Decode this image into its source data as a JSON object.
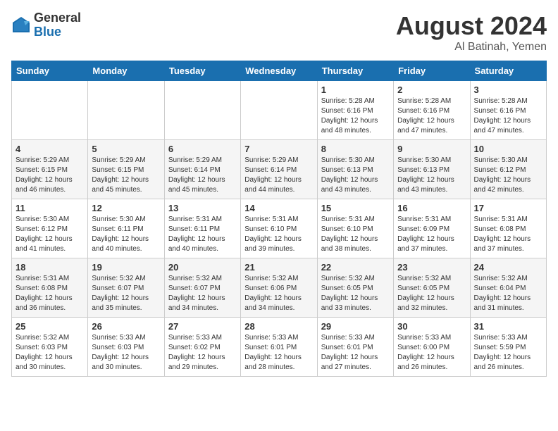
{
  "header": {
    "logo_general": "General",
    "logo_blue": "Blue",
    "month_year": "August 2024",
    "location": "Al Batinah, Yemen"
  },
  "weekdays": [
    "Sunday",
    "Monday",
    "Tuesday",
    "Wednesday",
    "Thursday",
    "Friday",
    "Saturday"
  ],
  "weeks": [
    [
      {
        "day": "",
        "info": ""
      },
      {
        "day": "",
        "info": ""
      },
      {
        "day": "",
        "info": ""
      },
      {
        "day": "",
        "info": ""
      },
      {
        "day": "1",
        "info": "Sunrise: 5:28 AM\nSunset: 6:16 PM\nDaylight: 12 hours\nand 48 minutes."
      },
      {
        "day": "2",
        "info": "Sunrise: 5:28 AM\nSunset: 6:16 PM\nDaylight: 12 hours\nand 47 minutes."
      },
      {
        "day": "3",
        "info": "Sunrise: 5:28 AM\nSunset: 6:16 PM\nDaylight: 12 hours\nand 47 minutes."
      }
    ],
    [
      {
        "day": "4",
        "info": "Sunrise: 5:29 AM\nSunset: 6:15 PM\nDaylight: 12 hours\nand 46 minutes."
      },
      {
        "day": "5",
        "info": "Sunrise: 5:29 AM\nSunset: 6:15 PM\nDaylight: 12 hours\nand 45 minutes."
      },
      {
        "day": "6",
        "info": "Sunrise: 5:29 AM\nSunset: 6:14 PM\nDaylight: 12 hours\nand 45 minutes."
      },
      {
        "day": "7",
        "info": "Sunrise: 5:29 AM\nSunset: 6:14 PM\nDaylight: 12 hours\nand 44 minutes."
      },
      {
        "day": "8",
        "info": "Sunrise: 5:30 AM\nSunset: 6:13 PM\nDaylight: 12 hours\nand 43 minutes."
      },
      {
        "day": "9",
        "info": "Sunrise: 5:30 AM\nSunset: 6:13 PM\nDaylight: 12 hours\nand 43 minutes."
      },
      {
        "day": "10",
        "info": "Sunrise: 5:30 AM\nSunset: 6:12 PM\nDaylight: 12 hours\nand 42 minutes."
      }
    ],
    [
      {
        "day": "11",
        "info": "Sunrise: 5:30 AM\nSunset: 6:12 PM\nDaylight: 12 hours\nand 41 minutes."
      },
      {
        "day": "12",
        "info": "Sunrise: 5:30 AM\nSunset: 6:11 PM\nDaylight: 12 hours\nand 40 minutes."
      },
      {
        "day": "13",
        "info": "Sunrise: 5:31 AM\nSunset: 6:11 PM\nDaylight: 12 hours\nand 40 minutes."
      },
      {
        "day": "14",
        "info": "Sunrise: 5:31 AM\nSunset: 6:10 PM\nDaylight: 12 hours\nand 39 minutes."
      },
      {
        "day": "15",
        "info": "Sunrise: 5:31 AM\nSunset: 6:10 PM\nDaylight: 12 hours\nand 38 minutes."
      },
      {
        "day": "16",
        "info": "Sunrise: 5:31 AM\nSunset: 6:09 PM\nDaylight: 12 hours\nand 37 minutes."
      },
      {
        "day": "17",
        "info": "Sunrise: 5:31 AM\nSunset: 6:08 PM\nDaylight: 12 hours\nand 37 minutes."
      }
    ],
    [
      {
        "day": "18",
        "info": "Sunrise: 5:31 AM\nSunset: 6:08 PM\nDaylight: 12 hours\nand 36 minutes."
      },
      {
        "day": "19",
        "info": "Sunrise: 5:32 AM\nSunset: 6:07 PM\nDaylight: 12 hours\nand 35 minutes."
      },
      {
        "day": "20",
        "info": "Sunrise: 5:32 AM\nSunset: 6:07 PM\nDaylight: 12 hours\nand 34 minutes."
      },
      {
        "day": "21",
        "info": "Sunrise: 5:32 AM\nSunset: 6:06 PM\nDaylight: 12 hours\nand 34 minutes."
      },
      {
        "day": "22",
        "info": "Sunrise: 5:32 AM\nSunset: 6:05 PM\nDaylight: 12 hours\nand 33 minutes."
      },
      {
        "day": "23",
        "info": "Sunrise: 5:32 AM\nSunset: 6:05 PM\nDaylight: 12 hours\nand 32 minutes."
      },
      {
        "day": "24",
        "info": "Sunrise: 5:32 AM\nSunset: 6:04 PM\nDaylight: 12 hours\nand 31 minutes."
      }
    ],
    [
      {
        "day": "25",
        "info": "Sunrise: 5:32 AM\nSunset: 6:03 PM\nDaylight: 12 hours\nand 30 minutes."
      },
      {
        "day": "26",
        "info": "Sunrise: 5:33 AM\nSunset: 6:03 PM\nDaylight: 12 hours\nand 30 minutes."
      },
      {
        "day": "27",
        "info": "Sunrise: 5:33 AM\nSunset: 6:02 PM\nDaylight: 12 hours\nand 29 minutes."
      },
      {
        "day": "28",
        "info": "Sunrise: 5:33 AM\nSunset: 6:01 PM\nDaylight: 12 hours\nand 28 minutes."
      },
      {
        "day": "29",
        "info": "Sunrise: 5:33 AM\nSunset: 6:01 PM\nDaylight: 12 hours\nand 27 minutes."
      },
      {
        "day": "30",
        "info": "Sunrise: 5:33 AM\nSunset: 6:00 PM\nDaylight: 12 hours\nand 26 minutes."
      },
      {
        "day": "31",
        "info": "Sunrise: 5:33 AM\nSunset: 5:59 PM\nDaylight: 12 hours\nand 26 minutes."
      }
    ]
  ]
}
